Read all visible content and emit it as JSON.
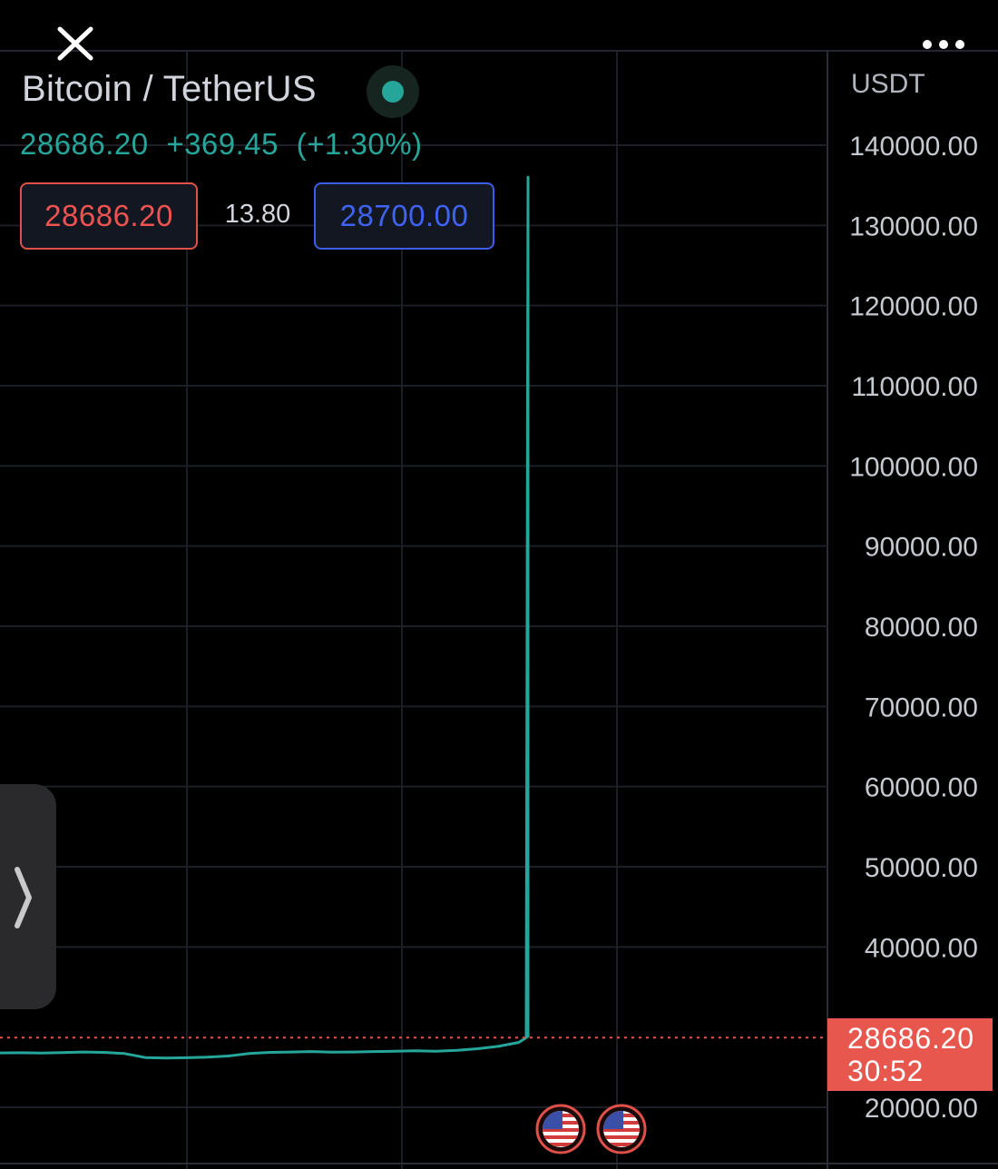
{
  "header": {
    "close_icon": "close-icon",
    "more_icon": "more-horizontal-icon"
  },
  "symbol": {
    "title": "Bitcoin / TetherUS",
    "status_color": "#26a69a",
    "last_price": "28686.20",
    "change": "+369.45",
    "change_percent": "(+1.30%)"
  },
  "quote": {
    "sell": "28686.20",
    "spread": "13.80",
    "buy": "28700.00"
  },
  "axis": {
    "currency": "USDT"
  },
  "price_tag": {
    "price": "28686.20",
    "countdown": "30:52"
  },
  "colors": {
    "up": "#26a69a",
    "down": "#ef5350",
    "buy": "#3f63f0",
    "price_tag": "#e8574e"
  },
  "events": [
    {
      "icon": "us-flag-icon"
    },
    {
      "icon": "us-flag-icon"
    }
  ],
  "chart_data": {
    "type": "line",
    "title": "",
    "ylabel": "",
    "xlabel": "",
    "ylim": [
      15000,
      145000
    ],
    "y_ticks": [
      "140000.00",
      "130000.00",
      "120000.00",
      "110000.00",
      "100000.00",
      "90000.00",
      "80000.00",
      "70000.00",
      "60000.00",
      "50000.00",
      "40000.00",
      "20000.00"
    ],
    "grid": true,
    "series": [
      {
        "values": [
          26780,
          26800,
          26760,
          26820,
          26900,
          26850,
          26700,
          26200,
          26150,
          26180,
          26250,
          26400,
          26700,
          26850,
          26900,
          26950,
          26870,
          26900,
          26950,
          27000,
          27050,
          26980,
          27100,
          27300,
          27600,
          28100,
          28686.2,
          136000,
          28686.2
        ]
      }
    ],
    "last_price_line": 28686.2
  }
}
